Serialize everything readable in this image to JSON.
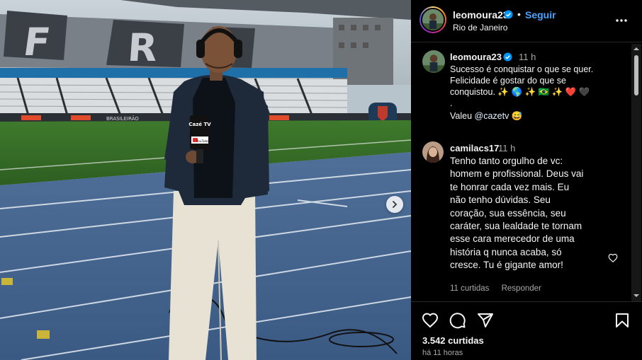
{
  "post": {
    "username": "leomoura23",
    "follow_label": "Seguir",
    "separator": "•",
    "location": "Rio de Janeiro"
  },
  "photo": {
    "mic_brand": "Cazé TV",
    "mic_sub": "YouTube",
    "field_text": "BRASILEIRÃO"
  },
  "caption": {
    "username": "leomoura23",
    "time": "11 h",
    "lines": [
      "Sucesso é conquistar o que se quer.",
      "Felicidade é gostar do que se",
      "conquistou. ✨ 🌎 ✨ 🇧🇷 ✨ ❤️ 🖤",
      "."
    ],
    "thanks": "Valeu",
    "mention": "@cazetv",
    "emoji": "😅"
  },
  "comment": {
    "username": "camilacs17",
    "time": "11 h",
    "lines": [
      "Tenho tanto orgulho de vc:",
      "homem e profissional. Deus vai",
      "te honrar cada vez mais. Eu",
      "não tenho dúvidas. Seu",
      "coração, sua essência, seu",
      "caráter, sua lealdade te tornam",
      "esse cara merecedor de uma",
      "história q nunca acaba, só",
      "cresce. Tu é gigante amor!"
    ],
    "likes": "11 curtidas",
    "reply": "Responder"
  },
  "footer": {
    "likes": "3.542 curtidas",
    "posted": "há 11 horas"
  },
  "icons": {
    "more": "more-options-icon",
    "like": "heart-icon",
    "comment": "comment-icon",
    "share": "send-icon",
    "save": "bookmark-icon",
    "next": "chevron-right-icon"
  },
  "colors": {
    "link": "#4aa3ff",
    "verified": "#0095f6",
    "panel_bg": "#000000",
    "muted": "#a8a8a8"
  }
}
